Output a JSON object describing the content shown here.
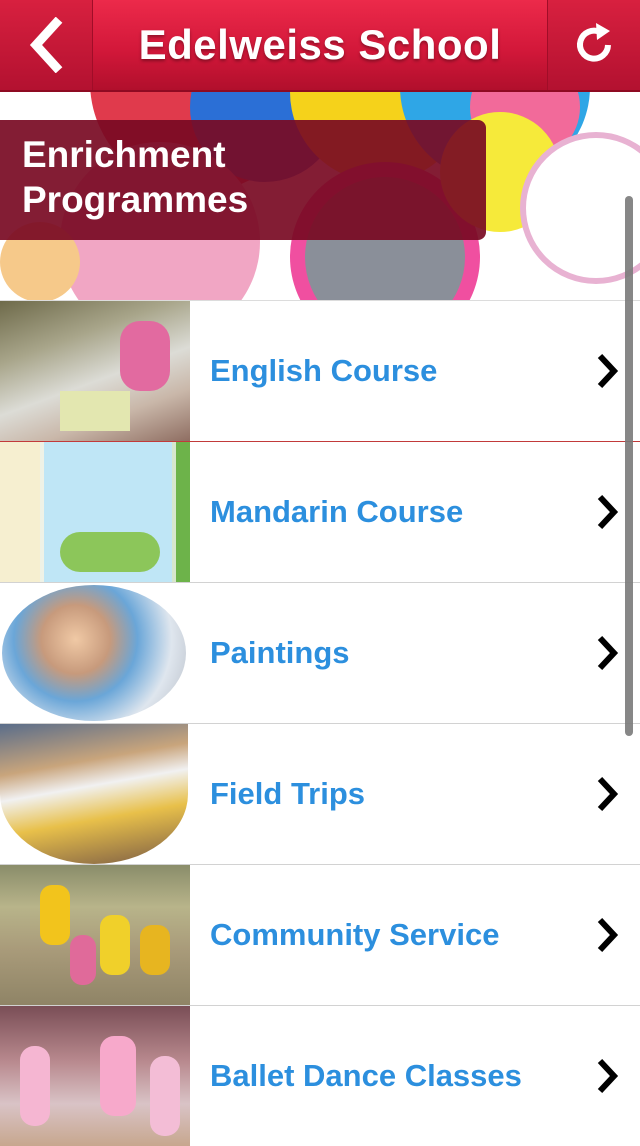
{
  "header": {
    "title": "Edelweiss School",
    "back_icon": "chevron-left-icon",
    "refresh_icon": "refresh-icon"
  },
  "banner": {
    "line1": "Enrichment",
    "line2": "Programmes"
  },
  "list": {
    "items": [
      {
        "label": "English Course",
        "thumb": "classroom-photo"
      },
      {
        "label": "Mandarin Course",
        "thumb": "mandarin-books-photo"
      },
      {
        "label": "Paintings",
        "thumb": "painting-photo"
      },
      {
        "label": "Field Trips",
        "thumb": "field-trip-photo"
      },
      {
        "label": "Community Service",
        "thumb": "community-photo"
      },
      {
        "label": "Ballet Dance Classes",
        "thumb": "ballet-photo"
      }
    ]
  },
  "colors": {
    "header_red": "#d3183a",
    "label_blue": "#2c8fde",
    "banner_label_bg": "#780a23"
  }
}
